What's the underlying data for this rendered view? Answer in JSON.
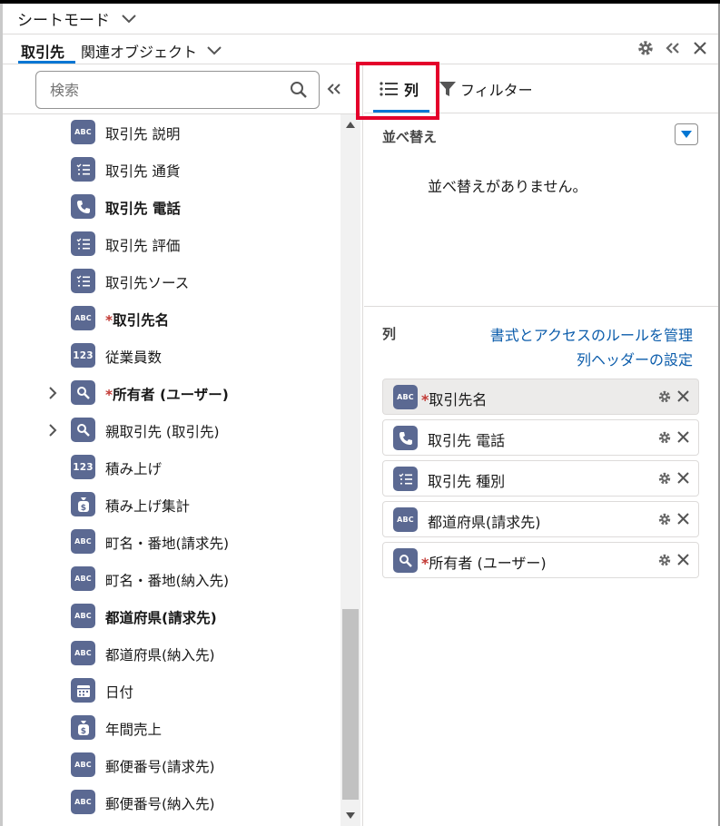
{
  "header": {
    "mode_title": "シートモード",
    "object_tab": "取引先",
    "related_tab": "関連オブジェクト"
  },
  "search": {
    "placeholder": "検索"
  },
  "fields": [
    {
      "label": "取引先 説明",
      "icon": "ABC",
      "bold": false,
      "required": false,
      "expandable": false
    },
    {
      "label": "取引先 通貨",
      "icon": "picklist",
      "bold": false,
      "required": false,
      "expandable": false
    },
    {
      "label": "取引先 電話",
      "icon": "phone",
      "bold": true,
      "required": false,
      "expandable": false
    },
    {
      "label": "取引先 評価",
      "icon": "picklist",
      "bold": false,
      "required": false,
      "expandable": false
    },
    {
      "label": "取引先ソース",
      "icon": "picklist",
      "bold": false,
      "required": false,
      "expandable": false
    },
    {
      "label": "取引先名",
      "icon": "ABC",
      "bold": true,
      "required": true,
      "expandable": false
    },
    {
      "label": "従業員数",
      "icon": "123",
      "bold": false,
      "required": false,
      "expandable": false
    },
    {
      "label": "所有者 (ユーザー)",
      "icon": "lookup",
      "bold": true,
      "required": true,
      "expandable": true
    },
    {
      "label": "親取引先 (取引先)",
      "icon": "lookup",
      "bold": false,
      "required": false,
      "expandable": true
    },
    {
      "label": "積み上げ",
      "icon": "123",
      "bold": false,
      "required": false,
      "expandable": false
    },
    {
      "label": "積み上げ集計",
      "icon": "currency",
      "bold": false,
      "required": false,
      "expandable": false
    },
    {
      "label": "町名・番地(請求先)",
      "icon": "ABC",
      "bold": false,
      "required": false,
      "expandable": false
    },
    {
      "label": "町名・番地(納入先)",
      "icon": "ABC",
      "bold": false,
      "required": false,
      "expandable": false
    },
    {
      "label": "都道府県(請求先)",
      "icon": "ABC",
      "bold": true,
      "required": false,
      "expandable": false
    },
    {
      "label": "都道府県(納入先)",
      "icon": "ABC",
      "bold": false,
      "required": false,
      "expandable": false
    },
    {
      "label": "日付",
      "icon": "calendar",
      "bold": false,
      "required": false,
      "expandable": false
    },
    {
      "label": "年間売上",
      "icon": "currency",
      "bold": false,
      "required": false,
      "expandable": false
    },
    {
      "label": "郵便番号(請求先)",
      "icon": "ABC",
      "bold": false,
      "required": false,
      "expandable": false
    },
    {
      "label": "郵便番号(納入先)",
      "icon": "ABC",
      "bold": false,
      "required": false,
      "expandable": false
    }
  ],
  "right_tabs": {
    "columns": "列",
    "filter": "フィルター"
  },
  "sort": {
    "title": "並べ替え",
    "empty": "並べ替えがありません。"
  },
  "columns": {
    "title": "列",
    "link_format": "書式とアクセスのルールを管理",
    "link_header": "列ヘッダーの設定",
    "items": [
      {
        "label": "取引先名",
        "icon": "ABC",
        "required": true,
        "selected": true
      },
      {
        "label": "取引先 電話",
        "icon": "phone",
        "required": false,
        "selected": false
      },
      {
        "label": "取引先 種別",
        "icon": "picklist",
        "required": false,
        "selected": false
      },
      {
        "label": "都道府県(請求先)",
        "icon": "ABC",
        "required": false,
        "selected": false
      },
      {
        "label": "所有者 (ユーザー)",
        "icon": "lookup",
        "required": true,
        "selected": false
      }
    ]
  },
  "colors": {
    "accent": "#0176d3",
    "icon_bg": "#5b6992",
    "required": "#c23934",
    "link": "#0b5cab",
    "highlight": "#e4002b"
  }
}
